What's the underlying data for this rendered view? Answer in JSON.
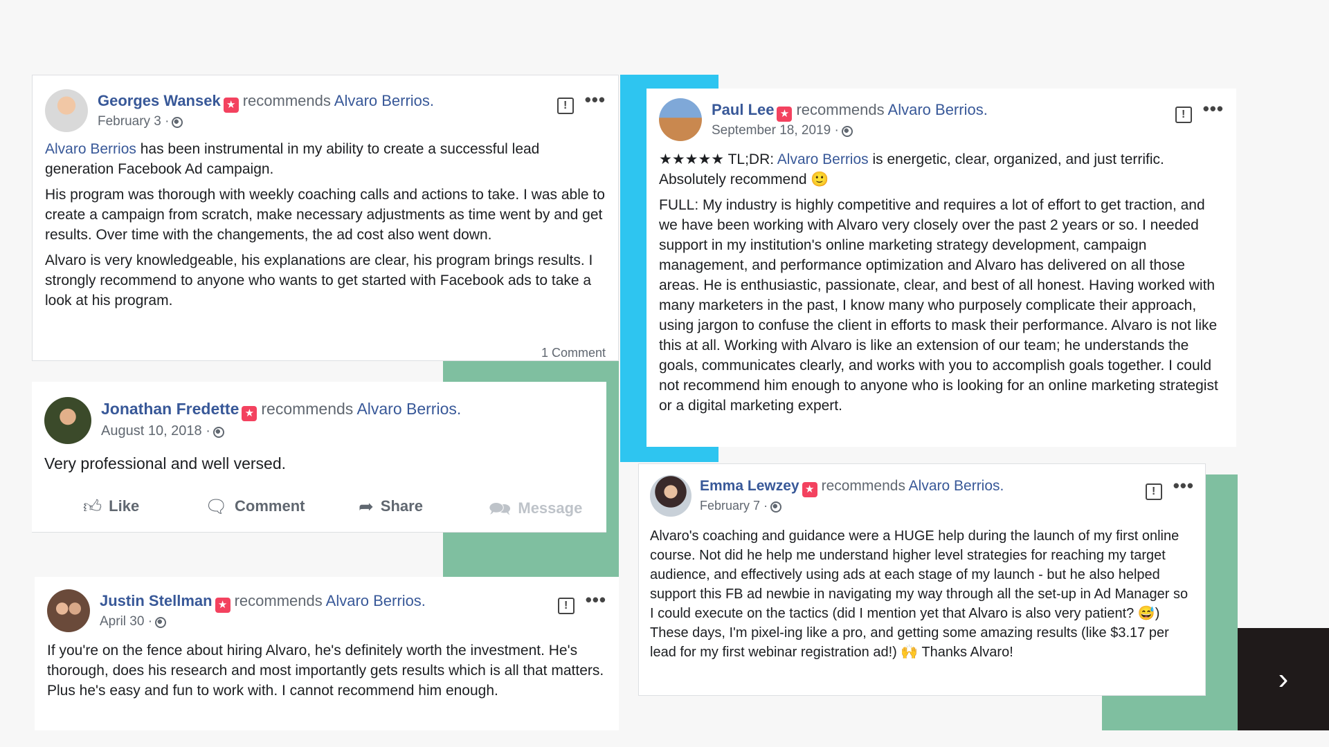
{
  "colors": {
    "accent_blue": "#2ec5f0",
    "accent_green": "#7fbfa0",
    "link": "#385898",
    "badge": "#f3425f",
    "dark_panel": "#1f1a1a"
  },
  "common": {
    "recommends": "recommends",
    "page_name": "Alvaro Berrios.",
    "separator": "·"
  },
  "reviews": [
    {
      "author": "Georges Wansek",
      "date": "February 3",
      "paragraphs": [
        {
          "link": "Alvaro Berrios",
          "text": " has been instrumental in my ability to create a successful lead generation Facebook Ad campaign."
        },
        {
          "text": "His program was thorough with weekly coaching calls and actions to take. I was able to create a campaign from scratch, make necessary adjustments as time went by and get results. Over time with the changements, the ad cost also went down."
        },
        {
          "text": "Alvaro is very knowledgeable, his explanations are clear, his program brings results. I strongly recommend to anyone who wants to get started with Facebook ads to take a look at his program."
        }
      ],
      "comment_count": "1 Comment"
    },
    {
      "author": "Jonathan Fredette",
      "date": "August 10, 2018",
      "paragraphs": [
        {
          "text": "Very professional and well versed."
        }
      ],
      "actions": {
        "like": "Like",
        "comment": "Comment",
        "share": "Share",
        "message": "Message"
      }
    },
    {
      "author": "Justin Stellman",
      "date": "April 30",
      "paragraphs": [
        {
          "text": "If you're on the fence about hiring Alvaro, he's definitely worth the investment. He's thorough, does his research and most importantly gets results which is all that matters. Plus he's easy and fun to work with. I cannot recommend him enough."
        }
      ]
    },
    {
      "author": "Paul Lee",
      "date": "September 18, 2019",
      "paragraphs": [
        {
          "pre": "★★★★★ TL;DR: ",
          "link": "Alvaro Berrios",
          "text": " is energetic, clear, organized, and just terrific. Absolutely recommend 🙂"
        },
        {
          "text": "FULL: My industry is highly competitive and requires a lot of effort to get traction, and we have been working with Alvaro very closely over the past 2 years or so. I needed support in my institution's online marketing strategy development, campaign management, and performance optimization and Alvaro has delivered on all those areas. He is enthusiastic, passionate, clear, and best of all honest. Having worked with many marketers in the past, I know many who purposely complicate their approach, using jargon to confuse the client in efforts to mask their performance. Alvaro is not like this at all. Working with Alvaro is like an extension of our team; he understands the goals, communicates clearly, and works with you to accomplish goals together. I could not recommend him enough to anyone who is looking for an online marketing strategist or a digital marketing expert."
        }
      ]
    },
    {
      "author": "Emma Lewzey",
      "date": "February 7",
      "paragraphs": [
        {
          "text": "Alvaro's coaching and guidance were a HUGE help during the launch of my first online course. Not did he help me understand higher level strategies for reaching my target audience, and effectively using ads at each stage of my launch - but he also helped support this FB ad newbie in navigating my way through all the set-up in Ad Manager so I could execute on the tactics (did I mention yet that Alvaro is also very patient? 😅) These days, I'm pixel-ing like a pro, and getting some amazing results (like $3.17 per lead for my first webinar registration ad!) 🙌 Thanks Alvaro!"
        }
      ]
    }
  ],
  "nav": {
    "next_icon": "chevron-right-icon",
    "next_glyph": "›"
  }
}
